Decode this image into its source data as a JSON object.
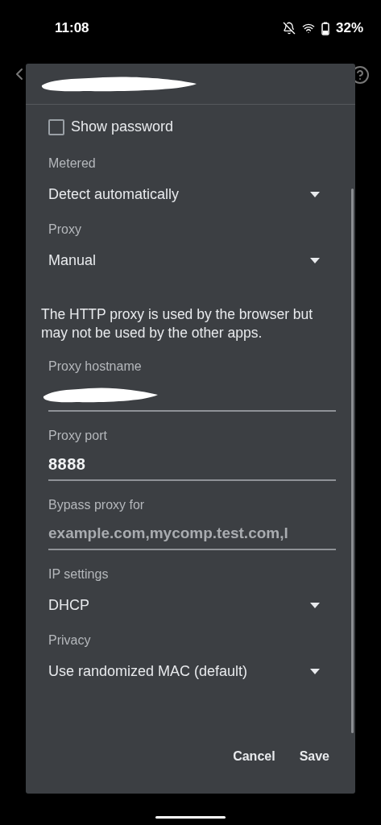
{
  "status_bar": {
    "time": "11:08",
    "battery": "32%"
  },
  "dialog": {
    "fields": [
      {
        "kind": "checkbox",
        "label": "Show password",
        "checked": false
      },
      {
        "kind": "dropdown",
        "label": "Metered",
        "value": "Detect automatically"
      },
      {
        "kind": "dropdown",
        "label": "Proxy",
        "value": "Manual"
      },
      {
        "kind": "note",
        "text": "The HTTP proxy is used by the browser but may not be used by the other apps."
      },
      {
        "kind": "text_field",
        "label": "Proxy hostname"
      },
      {
        "kind": "text_field",
        "label": "Proxy port",
        "value": "8888"
      },
      {
        "kind": "text_field",
        "label": "Bypass proxy for",
        "placeholder": "example.com,mycomp.test.com,l"
      },
      {
        "kind": "dropdown",
        "label": "IP settings",
        "value": "DHCP"
      },
      {
        "kind": "dropdown",
        "label": "Privacy",
        "value": "Use randomized MAC (default)"
      }
    ],
    "buttons": [
      "Cancel",
      "Save"
    ]
  }
}
